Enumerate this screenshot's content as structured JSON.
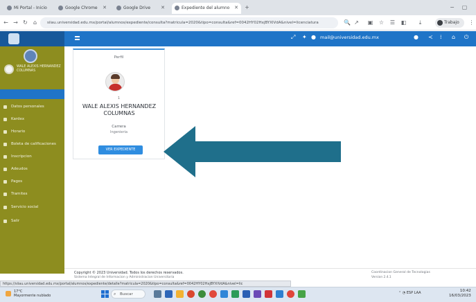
{
  "browser": {
    "tabs": [
      {
        "label": "Mi Portal - Inicio"
      },
      {
        "label": "Google Chrome"
      },
      {
        "label": "Google Drive"
      },
      {
        "label": "Expediente del alumno"
      }
    ],
    "url": "siiau.universidad.edu.mx/portal/alumnos/expediente/consulta?matricula=2020&tipo=consulta&ref=0042HY02HxjBYXlVdA&nivel=licenciatura",
    "profile_label": "Trabajo"
  },
  "header": {
    "email": "mail@universidad.edu.mx"
  },
  "sidebar": {
    "user_name": "WALE ALEXIS HERNANDEZ COLUMNAS",
    "items": [
      {
        "label": "Datos personales"
      },
      {
        "label": "Kardex"
      },
      {
        "label": "Horario"
      },
      {
        "label": "Boleta de calificaciones"
      },
      {
        "label": "Inscripcion"
      },
      {
        "label": "Adeudos"
      },
      {
        "label": "Pagos"
      },
      {
        "label": "Tramites"
      },
      {
        "label": "Servicio social"
      },
      {
        "label": "Salir"
      }
    ]
  },
  "card": {
    "title": "Perfil",
    "avatar_number": "1",
    "student_name": "WALE ALEXIS HERNANDEZ COLUMNAS",
    "field_label": "Carrera",
    "field_value": "Ingenieria",
    "button_label": "VER EXPEDIENTE"
  },
  "footer": {
    "copyright": "Copyright © 2023 Universidad. Todos los derechos reservados.",
    "line2": "Sistema Integral de Informacion y Administracion Universitaria",
    "right1": "Coordinacion General de Tecnologias",
    "right2": "Version 2.4.1"
  },
  "statusbar": {
    "text": "https://siiau.universidad.edu.mx/portal/alumnos/expediente/detalle?matricula=2020&tipo=consulta&ref=0042HY02HxjBYXlVdA&nivel=lic"
  },
  "taskbar": {
    "weather_temp": "17°C",
    "weather_desc": "Mayormente nublado",
    "search_label": "Buscar",
    "clock_time": "10:42",
    "clock_date": "16/03/2023",
    "tray_text": "ESP LAA"
  },
  "colors": {
    "header_blue": "#1f74c7",
    "sidebar_olive": "#8d8d1f",
    "arrow_blue": "#1f6f8b",
    "button_blue": "#2f8de0"
  }
}
